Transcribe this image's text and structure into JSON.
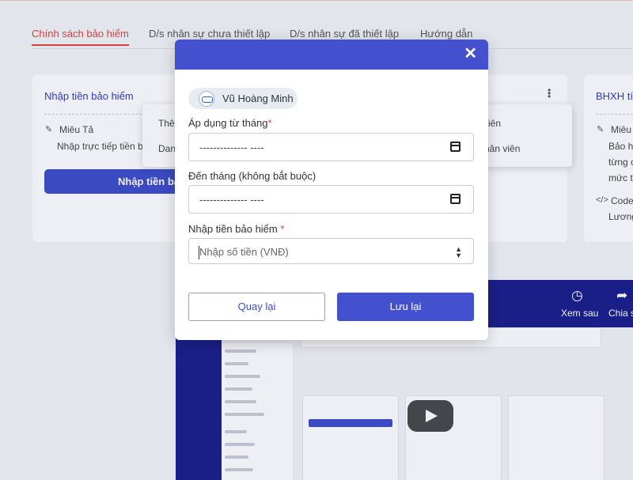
{
  "background": {
    "tabs": [
      {
        "label": "Chính sách bảo hiểm"
      },
      {
        "label": "D/s nhân sự chưa thiết lập"
      },
      {
        "label": "D/s nhân sự đã thiết lập"
      },
      {
        "label": "Hướng dẫn"
      }
    ],
    "card1": {
      "title": "Nhập tiền bảo hiểm",
      "desc_label": "Miêu Tả",
      "desc_text": "Nhập trực tiếp tiền b",
      "button": "Nhập tiền bả"
    },
    "dropdown": {
      "item1_left": "Thê",
      "item1_right": "iên",
      "item2_left": "Dan",
      "item2_right": "hân viên"
    },
    "card2": {
      "title": "BHXH tí",
      "desc_label": "Miêu",
      "desc_lines": [
        "Bảo h",
        "từng c",
        "mức t"
      ],
      "code_label": "Code",
      "code_text": "Lương"
    },
    "video": {
      "watch_later": "Xem sau",
      "share": "Chia s"
    }
  },
  "modal": {
    "employee_name": "Vũ Hoàng Minh",
    "from_month_label": "Áp dụng từ tháng",
    "from_month_required": "*",
    "from_month_value": "-------------- ----",
    "to_month_label": "Đến tháng (không bắt buộc)",
    "to_month_value": "-------------- ----",
    "amount_label": "Nhập tiền bảo hiểm",
    "amount_required": "*",
    "amount_placeholder": "Nhập số tiền (VNĐ)",
    "back_button": "Quay lại",
    "save_button": "Lưu lại"
  }
}
